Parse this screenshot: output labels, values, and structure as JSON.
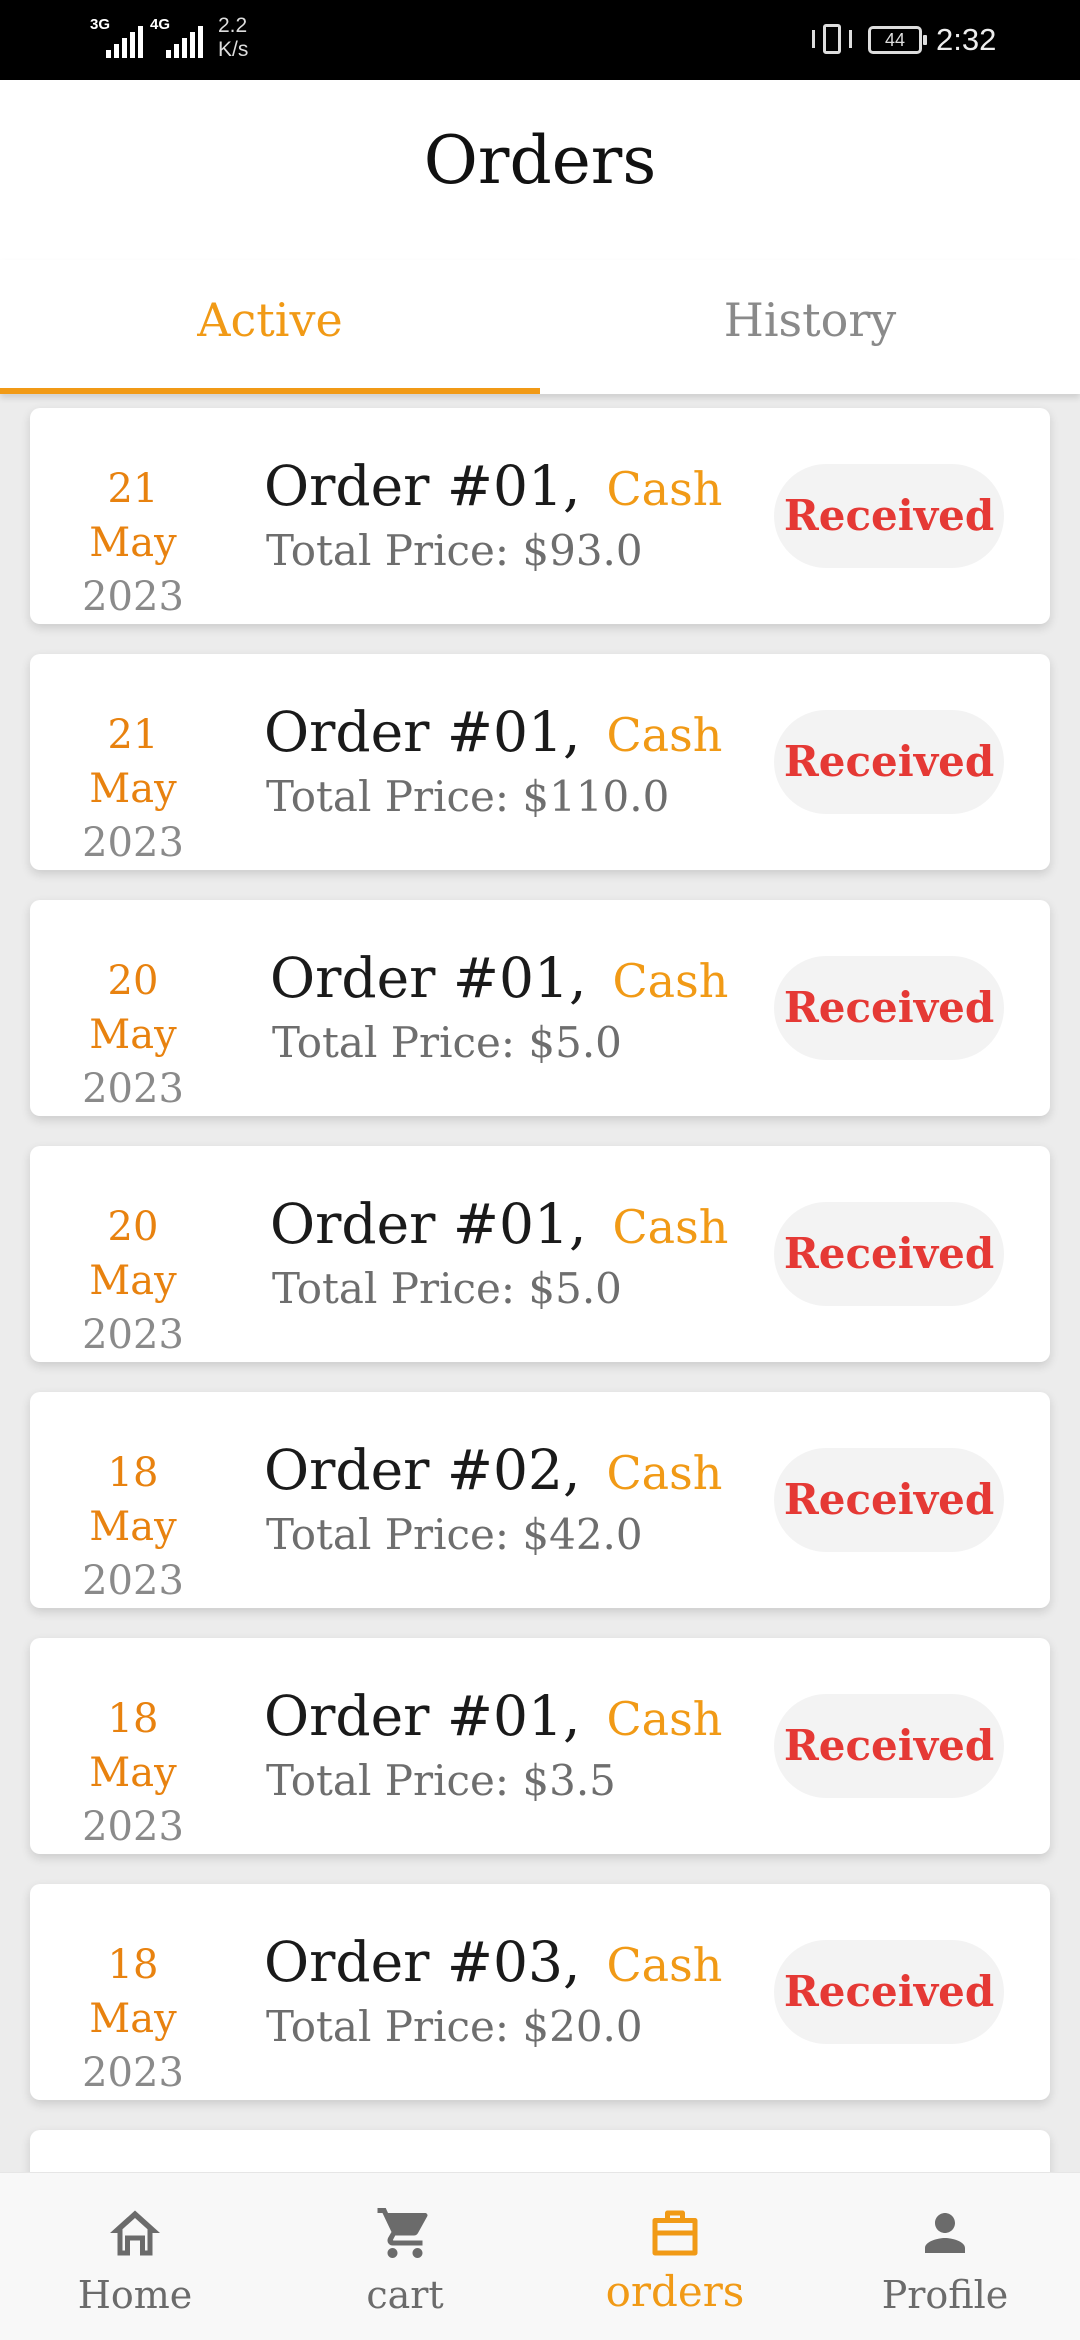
{
  "status_bar": {
    "network1": "3G",
    "network2": "4G",
    "speed_value": "2.2",
    "speed_unit": "K/s",
    "battery": "44",
    "time": "2:32"
  },
  "header": {
    "title": "Orders"
  },
  "tabs": [
    {
      "label": "Active",
      "selected": true
    },
    {
      "label": "History",
      "selected": false
    }
  ],
  "orders": [
    {
      "day": "21 May",
      "year": "2023",
      "order": "Order #01,",
      "payment": "Cash",
      "price": "Total Price: $93.0",
      "status": "Received"
    },
    {
      "day": "21 May",
      "year": "2023",
      "order": "Order #01,",
      "payment": "Cash",
      "price": "Total Price: $110.0",
      "status": "Received"
    },
    {
      "day": "20 May",
      "year": "2023",
      "order": "Order #01,",
      "payment": "Cash",
      "price": "Total Price: $5.0",
      "status": "Received"
    },
    {
      "day": "20 May",
      "year": "2023",
      "order": "Order #01,",
      "payment": "Cash",
      "price": "Total Price: $5.0",
      "status": "Received"
    },
    {
      "day": "18 May",
      "year": "2023",
      "order": "Order #02,",
      "payment": "Cash",
      "price": "Total Price: $42.0",
      "status": "Received"
    },
    {
      "day": "18 May",
      "year": "2023",
      "order": "Order #01,",
      "payment": "Cash",
      "price": "Total Price: $3.5",
      "status": "Received"
    },
    {
      "day": "18 May",
      "year": "2023",
      "order": "Order #03,",
      "payment": "Cash",
      "price": "Total Price: $20.0",
      "status": "Received"
    }
  ],
  "bottom_nav": [
    {
      "label": "Home",
      "icon": "home-icon",
      "active": false
    },
    {
      "label": "cart",
      "icon": "cart-icon",
      "active": false
    },
    {
      "label": "orders",
      "icon": "briefcase-icon",
      "active": true
    },
    {
      "label": "Profile",
      "icon": "person-icon",
      "active": false
    }
  ],
  "colors": {
    "accent": "#f19a16",
    "date_accent": "#e8820f",
    "status_text": "#e53935",
    "status_bg": "#f3f3f3"
  }
}
